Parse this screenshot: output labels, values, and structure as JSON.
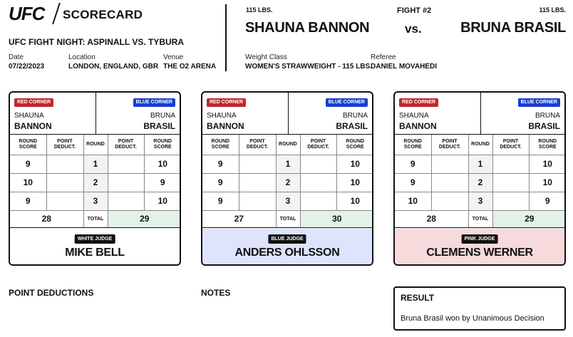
{
  "header": {
    "logo_text": "UFC",
    "title": "SCORECARD",
    "event_name": "UFC FIGHT NIGHT: ASPINALL VS. TYBURA",
    "date_label": "Date",
    "date": "07/22/2023",
    "location_label": "Location",
    "location": "LONDON, ENGLAND, GBR",
    "venue_label": "Venue",
    "venue": "THE O2 ARENA"
  },
  "fight": {
    "number": "FIGHT #2",
    "vs": "vs.",
    "red_weight": "115 LBS.",
    "blue_weight": "115 LBS.",
    "red_name": "SHAUNA BANNON",
    "blue_name": "BRUNA BRASIL",
    "weight_class_label": "Weight Class",
    "weight_class": "WOMEN'S STRAWWEIGHT - 115 LBS.",
    "referee_label": "Referee",
    "referee": "DANIEL MOVAHEDI"
  },
  "labels": {
    "red_corner": "RED CORNER",
    "blue_corner": "BLUE CORNER",
    "round_score_1": "ROUND",
    "round_score_2": "SCORE",
    "point_deduct_1": "POINT",
    "point_deduct_2": "DEDUCT.",
    "round": "ROUND",
    "total": "TOTAL",
    "point_deductions": "POINT DEDUCTIONS",
    "notes": "NOTES",
    "result": "RESULT"
  },
  "red_fighter": {
    "first": "SHAUNA",
    "last": "BANNON"
  },
  "blue_fighter": {
    "first": "BRUNA",
    "last": "BRASIL"
  },
  "judges": [
    {
      "badge": "WHITE JUDGE",
      "name": "MIKE BELL",
      "rounds": [
        {
          "round": "1",
          "red": "9",
          "red_ded": "",
          "blue_ded": "",
          "blue": "10"
        },
        {
          "round": "2",
          "red": "10",
          "red_ded": "",
          "blue_ded": "",
          "blue": "9"
        },
        {
          "round": "3",
          "red": "9",
          "red_ded": "",
          "blue_ded": "",
          "blue": "10"
        }
      ],
      "red_total": "28",
      "blue_total": "29"
    },
    {
      "badge": "BLUE JUDGE",
      "name": "ANDERS OHLSSON",
      "rounds": [
        {
          "round": "1",
          "red": "9",
          "red_ded": "",
          "blue_ded": "",
          "blue": "10"
        },
        {
          "round": "2",
          "red": "9",
          "red_ded": "",
          "blue_ded": "",
          "blue": "10"
        },
        {
          "round": "3",
          "red": "9",
          "red_ded": "",
          "blue_ded": "",
          "blue": "10"
        }
      ],
      "red_total": "27",
      "blue_total": "30"
    },
    {
      "badge": "PINK JUDGE",
      "name": "CLEMENS WERNER",
      "rounds": [
        {
          "round": "1",
          "red": "9",
          "red_ded": "",
          "blue_ded": "",
          "blue": "10"
        },
        {
          "round": "2",
          "red": "9",
          "red_ded": "",
          "blue_ded": "",
          "blue": "10"
        },
        {
          "round": "3",
          "red": "10",
          "red_ded": "",
          "blue_ded": "",
          "blue": "9"
        }
      ],
      "red_total": "28",
      "blue_total": "29"
    }
  ],
  "result": {
    "text": "Bruna Brasil won by Unanimous Decision"
  },
  "colors": {
    "red_corner": "#c0272d",
    "blue_corner": "#1a3ecf",
    "winner_total_bg": "#e3f2e8",
    "blue_judge_bg": "#dde4fb",
    "pink_judge_bg": "#f7dadb"
  }
}
